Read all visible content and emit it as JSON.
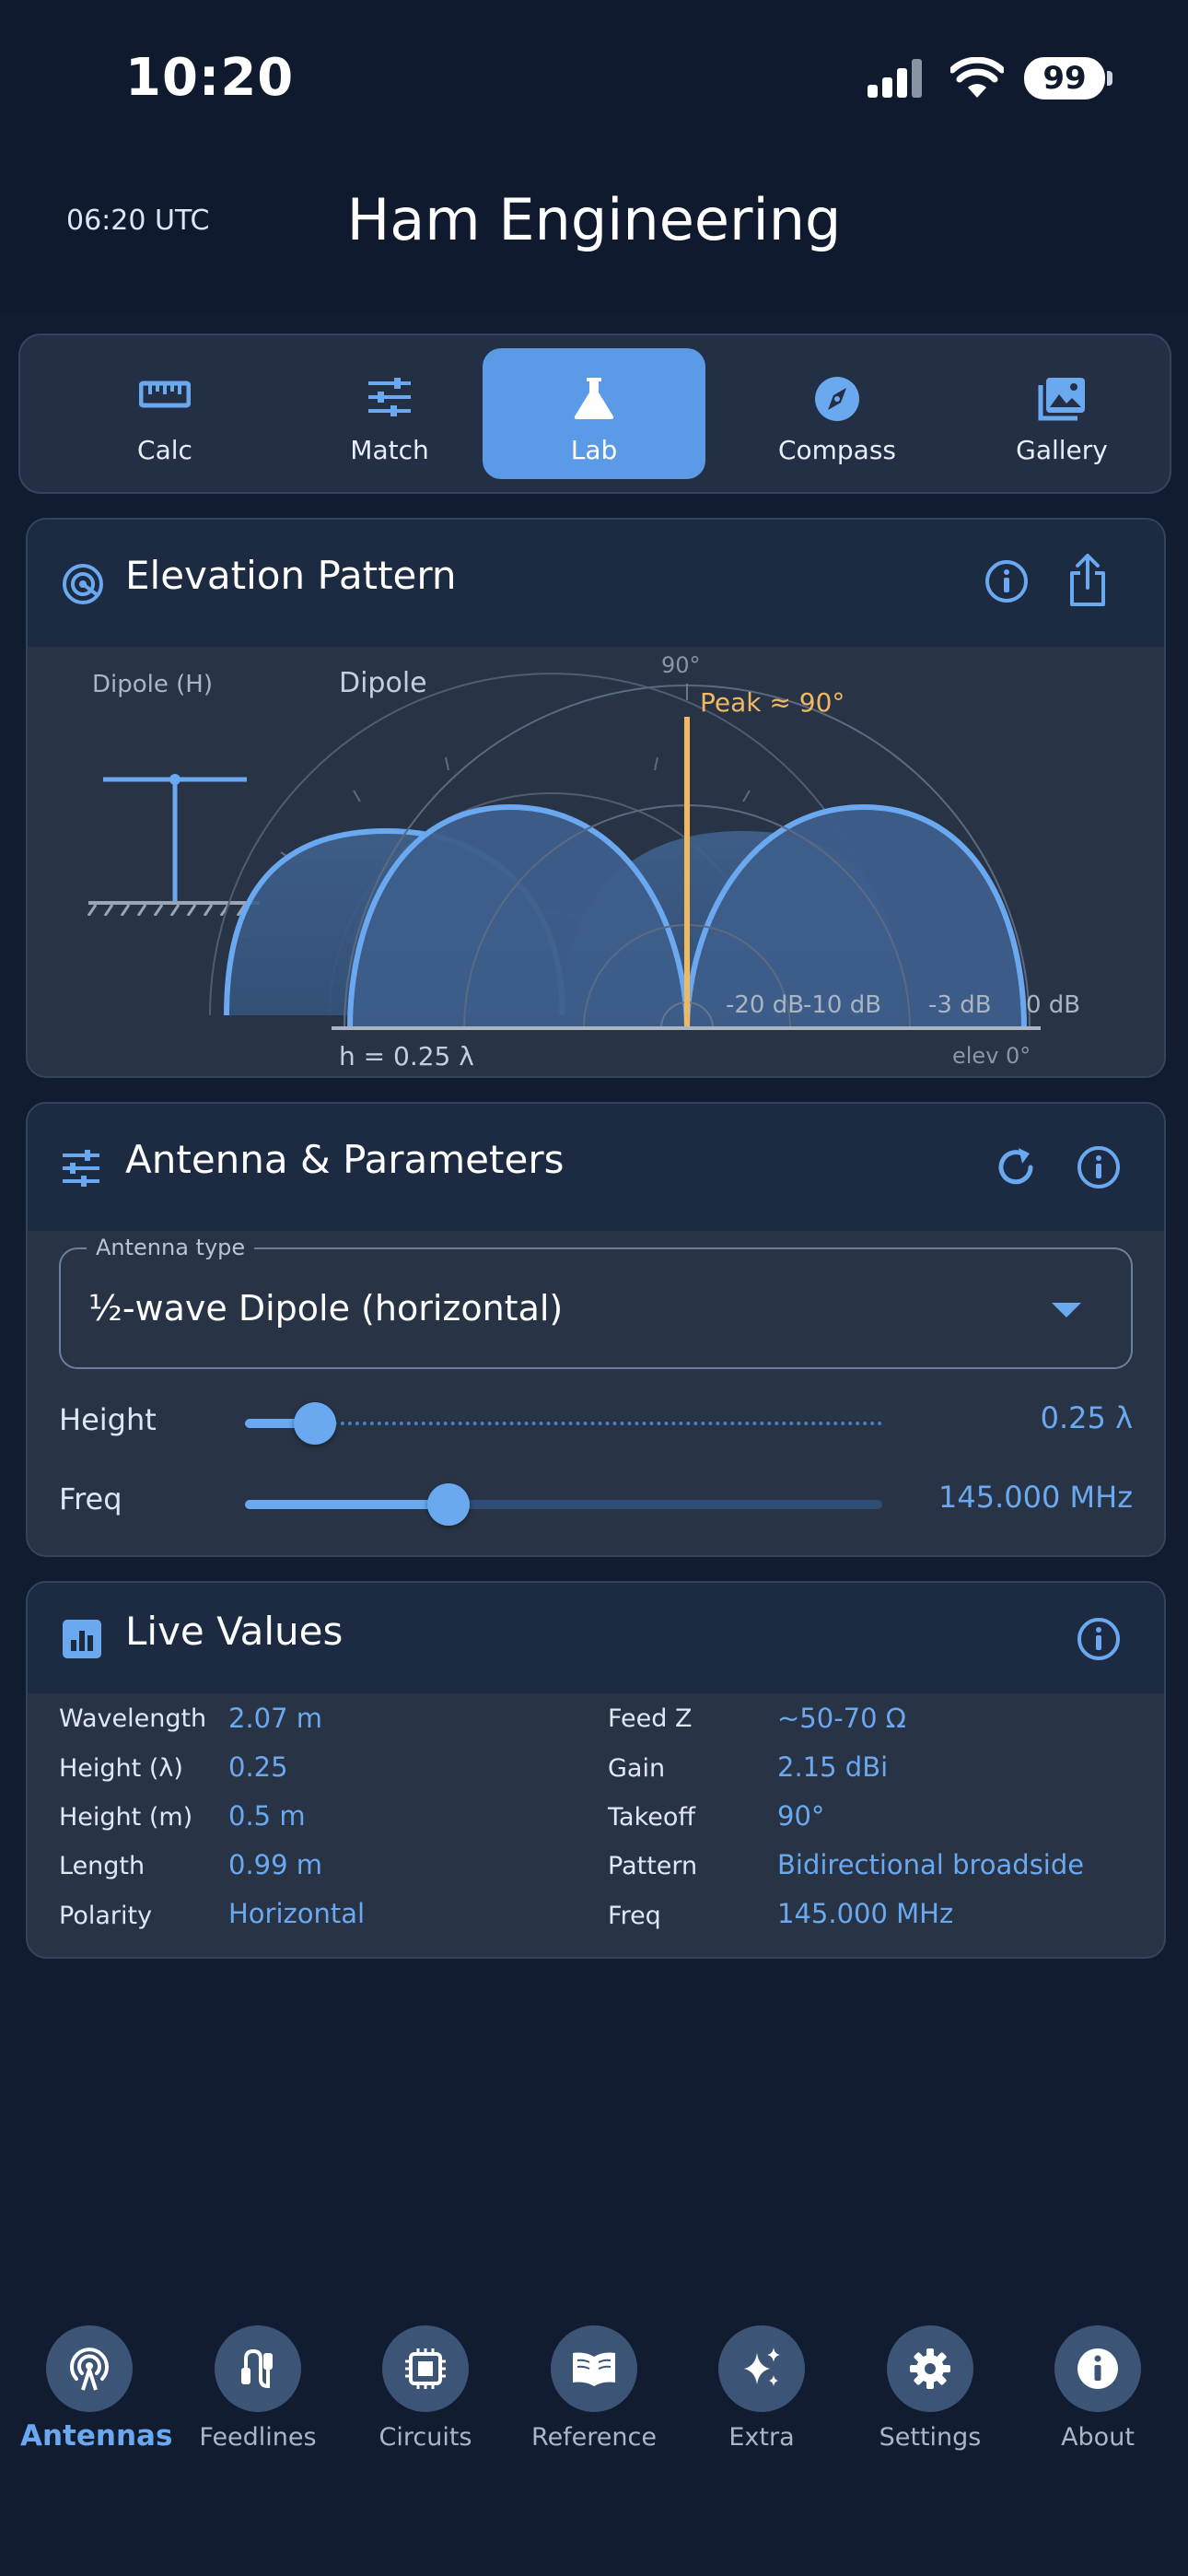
{
  "status": {
    "time": "10:20",
    "battery": "99"
  },
  "header": {
    "utc": "06:20 UTC",
    "title": "Ham Engineering"
  },
  "tabs": [
    {
      "label": "Calc",
      "icon": "ruler-icon"
    },
    {
      "label": "Match",
      "icon": "sliders-icon"
    },
    {
      "label": "Lab",
      "icon": "flask-icon",
      "active": true
    },
    {
      "label": "Compass",
      "icon": "compass-icon"
    },
    {
      "label": "Gallery",
      "icon": "image-icon"
    }
  ],
  "pattern": {
    "title": "Elevation Pattern",
    "left_label": "Dipole (H)",
    "plot_label": "Dipole",
    "top_angle": "90°",
    "peak_label": "Peak ≈ 90°",
    "rings": [
      "-20 dB",
      "-10 dB",
      "-3 dB",
      "0 dB"
    ],
    "height_label": "h = 0.25 λ",
    "elev_label": "elev 0°"
  },
  "params": {
    "title": "Antenna & Parameters",
    "antenna_type_label": "Antenna type",
    "antenna_type_value": "½-wave Dipole (horizontal)",
    "height_label": "Height",
    "height_value": "0.25 λ",
    "height_fraction": 0.11,
    "freq_label": "Freq",
    "freq_value": "145.000 MHz",
    "freq_fraction": 0.32
  },
  "live": {
    "title": "Live Values",
    "left": [
      {
        "key": "Wavelength",
        "value": "2.07 m"
      },
      {
        "key": "Height (λ)",
        "value": "0.25"
      },
      {
        "key": "Height (m)",
        "value": "0.5 m"
      },
      {
        "key": "Length",
        "value": "0.99 m"
      },
      {
        "key": "Polarity",
        "value": "Horizontal"
      }
    ],
    "right": [
      {
        "key": "Feed Z",
        "value": "~50-70 Ω"
      },
      {
        "key": "Gain",
        "value": "2.15 dBi"
      },
      {
        "key": "Takeoff",
        "value": "90°"
      },
      {
        "key": "Pattern",
        "value": "Bidirectional broadside"
      },
      {
        "key": "Freq",
        "value": "145.000 MHz"
      }
    ]
  },
  "nav": [
    {
      "label": "Antennas",
      "icon": "antenna-icon",
      "active": true
    },
    {
      "label": "Feedlines",
      "icon": "cable-icon"
    },
    {
      "label": "Circuits",
      "icon": "circuit-icon"
    },
    {
      "label": "Reference",
      "icon": "book-icon"
    },
    {
      "label": "Extra",
      "icon": "sparkle-icon"
    },
    {
      "label": "Settings",
      "icon": "gear-icon"
    },
    {
      "label": "About",
      "icon": "info-icon"
    }
  ],
  "colors": {
    "accent": "#6aa8f0",
    "peak": "#f0b860",
    "background": "#111c30",
    "card": "#283446"
  }
}
